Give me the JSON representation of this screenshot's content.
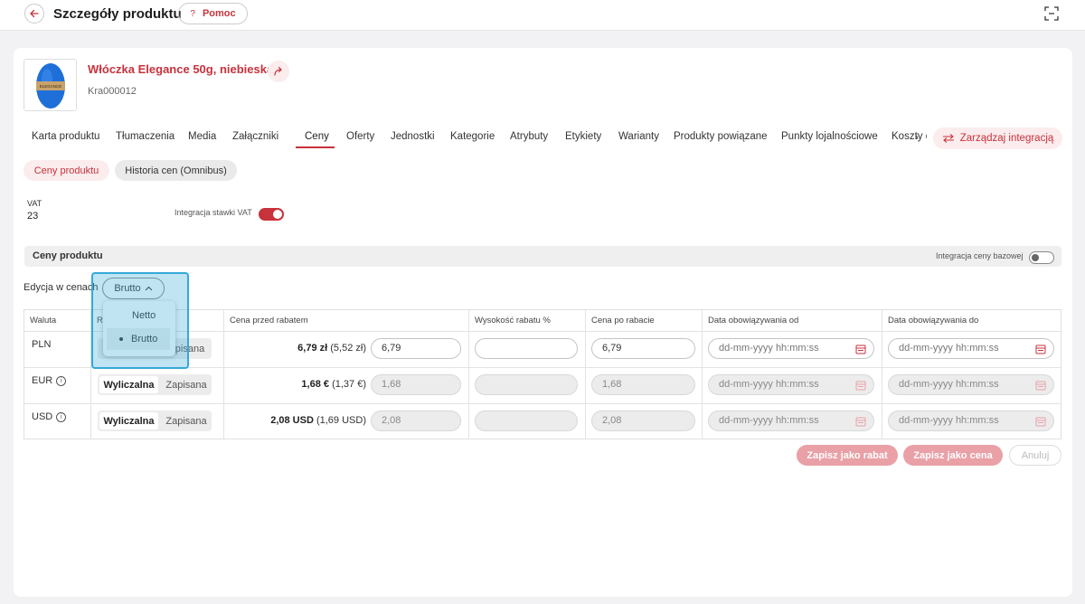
{
  "header": {
    "title": "Szczegóły produktu",
    "help_label": "Pomoc",
    "help_icon_glyph": "?"
  },
  "product": {
    "name": "Włóczka Elegance 50g, niebieska",
    "code": "Kra000012",
    "thumb_label": "ELEGANCE"
  },
  "tabs": [
    {
      "label": "Karta produktu",
      "active": false
    },
    {
      "label": "Tłumaczenia",
      "active": false
    },
    {
      "label": "Media",
      "active": false
    },
    {
      "label": "Załączniki",
      "active": false
    },
    {
      "label": "Ceny",
      "active": true
    },
    {
      "label": "Oferty",
      "active": false
    },
    {
      "label": "Jednostki",
      "active": false
    },
    {
      "label": "Kategorie",
      "active": false
    },
    {
      "label": "Atrybuty",
      "active": false
    },
    {
      "label": "Etykiety",
      "active": false
    },
    {
      "label": "Warianty",
      "active": false
    },
    {
      "label": "Produkty powiązane",
      "active": false
    },
    {
      "label": "Punkty lojalnościowe",
      "active": false
    },
    {
      "label": "Koszty d",
      "active": false
    }
  ],
  "manage_integration_label": "Zarządzaj integracją",
  "subtabs": {
    "prices": "Ceny produktu",
    "history": "Historia cen (Omnibus)"
  },
  "vat": {
    "label": "VAT",
    "value": "23",
    "integration_label": "Integracja stawki VAT",
    "integration_on": true
  },
  "section": {
    "title": "Ceny produktu",
    "base_integration_label": "Integracja ceny bazowej",
    "base_integration_on": false
  },
  "edit": {
    "label": "Edycja w cenach",
    "selected": "Brutto",
    "options": [
      "Netto",
      "Brutto"
    ]
  },
  "table": {
    "headers": [
      "Waluta",
      "R",
      "Cena przed rabatem",
      "Wysokość rabatu %",
      "Cena po rabacie",
      "Data obowiązywania od",
      "Data obowiązywania do"
    ],
    "seg_labels": [
      "Wyliczalna",
      "Zapisana"
    ],
    "seg_partial": "pisana",
    "date_placeholder": "dd-mm-yyyy hh:mm:ss",
    "rows": [
      {
        "currency": "PLN",
        "info": false,
        "price_bold": "6,79 zł",
        "price_net": "(5,52 zł)",
        "price_input": "6,79",
        "discount": "",
        "after": "6,79",
        "editable": true
      },
      {
        "currency": "EUR",
        "info": true,
        "price_bold": "1,68 €",
        "price_net": "(1,37 €)",
        "price_input": "1,68",
        "discount": "",
        "after": "1,68",
        "editable": false
      },
      {
        "currency": "USD",
        "info": true,
        "price_bold": "2,08 USD",
        "price_net": "(1,69 USD)",
        "price_input": "2,08",
        "discount": "",
        "after": "2,08",
        "editable": false
      }
    ]
  },
  "actions": {
    "save_discount": "Zapisz jako rabat",
    "save_price": "Zapisz jako cena",
    "cancel": "Anuluj"
  },
  "colors": {
    "accent": "#c8323c",
    "accent_light": "#fbeced",
    "highlight": "#35a9d8"
  }
}
